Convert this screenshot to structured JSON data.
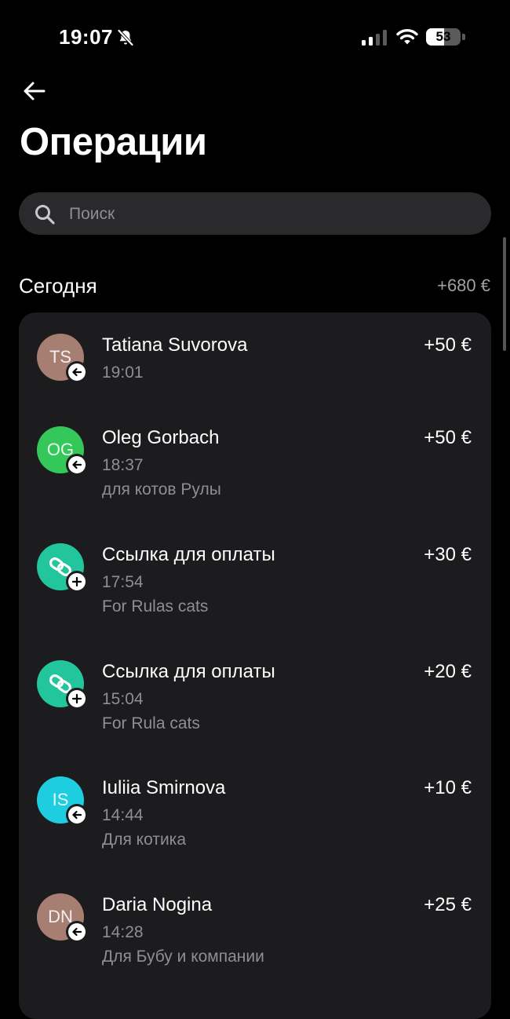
{
  "status_bar": {
    "time": "19:07",
    "battery_level": "53",
    "battery_fraction": 0.53
  },
  "header": {
    "back_icon": "arrow-left-icon",
    "title": "Операции"
  },
  "search": {
    "placeholder": "Поиск",
    "value": ""
  },
  "section": {
    "title": "Сегодня",
    "total": "+680 €"
  },
  "transactions": [
    {
      "initials": "TS",
      "avatar_color": "#a77f72",
      "badge": "arrow-left-icon",
      "name": "Tatiana Suvorova",
      "time": "19:01",
      "note": "",
      "amount": "+50 €"
    },
    {
      "initials": "OG",
      "avatar_color": "#34c759",
      "badge": "arrow-left-icon",
      "name": "Oleg Gorbach",
      "time": "18:37",
      "note": "для котов Рулы",
      "amount": "+50 €"
    },
    {
      "initials": "",
      "avatar_color": "#22c59c",
      "avatar_icon": "link-icon",
      "badge": "plus-icon",
      "name": "Ссылка для оплаты",
      "time": "17:54",
      "note": "For Rulas cats",
      "amount": "+30 €"
    },
    {
      "initials": "",
      "avatar_color": "#22c59c",
      "avatar_icon": "link-icon",
      "badge": "plus-icon",
      "name": "Ссылка для оплаты",
      "time": "15:04",
      "note": "For Rula cats",
      "amount": "+20 €"
    },
    {
      "initials": "IS",
      "avatar_color": "#1fcde0",
      "badge": "arrow-left-icon",
      "name": "Iuliia Smirnova",
      "time": "14:44",
      "note": "Для котика",
      "amount": "+10 €"
    },
    {
      "initials": "DN",
      "avatar_color": "#a77f72",
      "badge": "arrow-left-icon",
      "name": "Daria Nogina",
      "time": "14:28",
      "note": "Для Бубу и компании",
      "amount": "+25 €"
    }
  ]
}
